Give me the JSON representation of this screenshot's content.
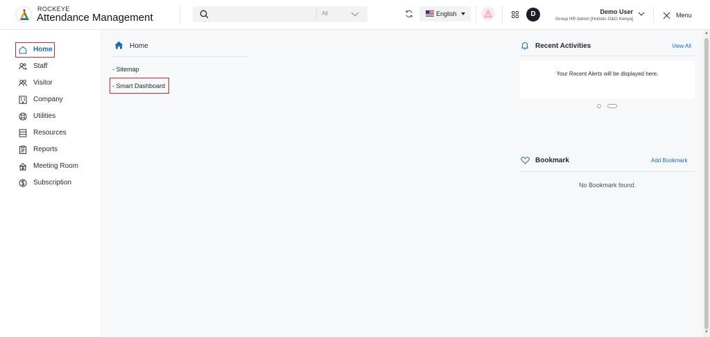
{
  "header": {
    "brand_top": "ROCKEYE",
    "brand_main": "Attendance Management",
    "search": {
      "placeholder": "",
      "filter_label": "All"
    },
    "language": "English",
    "user": {
      "initial": "D",
      "name": "Demo User",
      "role": "Group HR Admin [Holistic O&G Kenya]"
    },
    "menu_label": "Menu"
  },
  "sidebar": {
    "items": [
      {
        "label": "Home",
        "icon": "home-icon"
      },
      {
        "label": "Staff",
        "icon": "staff-icon"
      },
      {
        "label": "Visitor",
        "icon": "visitor-icon"
      },
      {
        "label": "Company",
        "icon": "company-icon"
      },
      {
        "label": "Utilities",
        "icon": "utilities-icon"
      },
      {
        "label": "Resources",
        "icon": "resources-icon"
      },
      {
        "label": "Reports",
        "icon": "reports-icon"
      },
      {
        "label": "Meeting Room",
        "icon": "meeting-room-icon"
      },
      {
        "label": "Subscription",
        "icon": "subscription-icon"
      }
    ],
    "active_index": 0
  },
  "main": {
    "breadcrumb": "Home",
    "links": [
      "- Sitemap",
      "- Smart Dashboard"
    ]
  },
  "recent": {
    "title": "Recent Activities",
    "view_all": "View All",
    "empty_text": "Your Recent Alerts will be displayed here."
  },
  "bookmark": {
    "title": "Bookmark",
    "add_label": "Add Bookmark",
    "empty_text": "No Bookmark found."
  },
  "colors": {
    "accent": "#1967d2",
    "highlight": "#e02424",
    "alert_bg": "#fde8ea"
  }
}
